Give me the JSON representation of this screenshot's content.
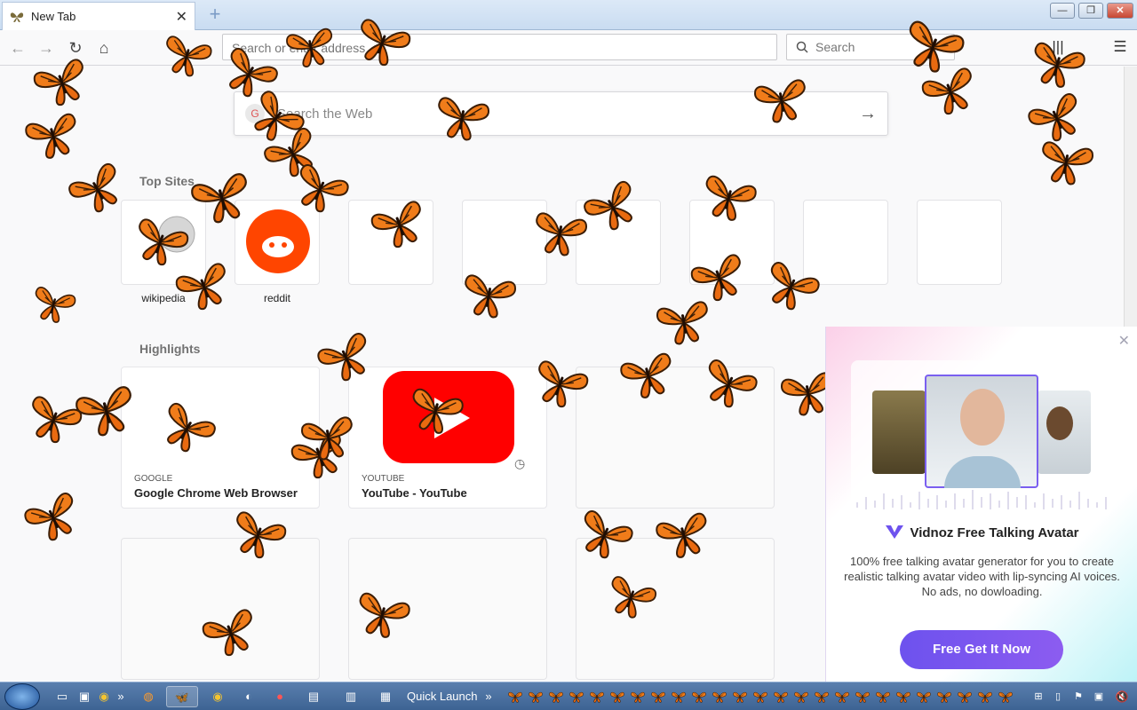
{
  "browser": {
    "tab_title": "New Tab",
    "new_tab_symbol": "+",
    "window_buttons": [
      "—",
      "❐",
      "✕"
    ],
    "url_placeholder": "Search or enter address",
    "search_placeholder": "Search"
  },
  "page": {
    "web_search_placeholder": "Search the Web",
    "top_sites_title": "Top Sites",
    "top_sites": [
      {
        "label": "wikipedia"
      },
      {
        "label": "reddit"
      }
    ],
    "highlights_title": "Highlights",
    "highlights": [
      {
        "host": "GOOGLE",
        "title": "Google Chrome Web Browser"
      },
      {
        "host": "YOUTUBE",
        "title": "YouTube - YouTube"
      }
    ]
  },
  "ad": {
    "brand": "Vidnoz Free Talking Avatar",
    "description": "100% free talking avatar generator for you to create realistic talking avatar video with lip-syncing AI voices. No ads, no dowloading.",
    "cta": "Free Get It Now",
    "close_symbol": "✕"
  },
  "taskbar": {
    "quick_launch": "Quick Launch",
    "chevron": "»"
  },
  "colors": {
    "butterfly": "#f07c1a",
    "reddit": "#ff4500",
    "youtube": "#ff0000",
    "cta": "#7356ef"
  }
}
